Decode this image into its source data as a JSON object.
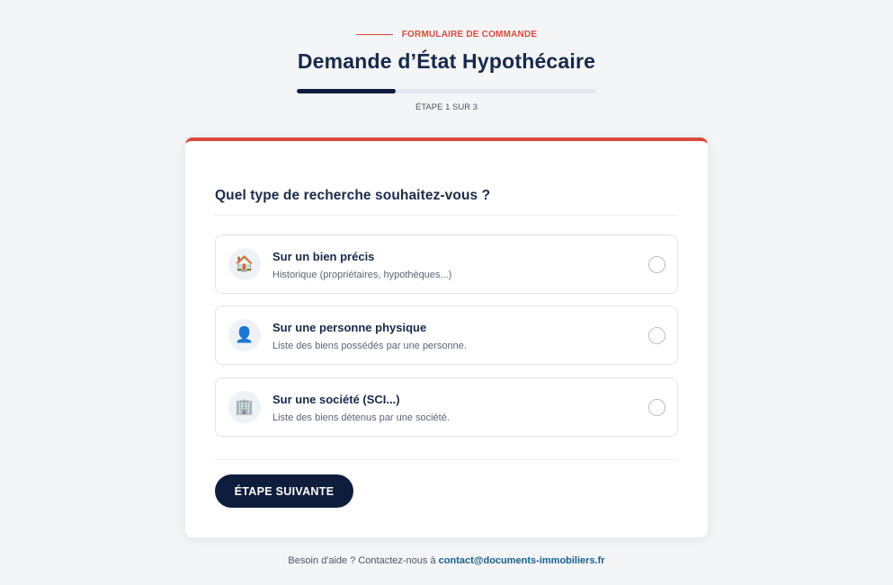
{
  "header": {
    "eyebrow": "FORMULAIRE DE COMMANDE",
    "title": "Demande d’État Hypothécaire",
    "progress_fraction": 0.33,
    "step_text": "ÉTAPE 1 SUR 3"
  },
  "form": {
    "question": "Quel type de recherche souhaitez-vous ?",
    "options": [
      {
        "icon": "🏠",
        "icon_name": "house-icon",
        "title": "Sur un bien précis",
        "description": "Historique (propriétaires, hypothèques...)",
        "selected": false
      },
      {
        "icon": "👤",
        "icon_name": "person-icon",
        "title": "Sur une personne physique",
        "description": "Liste des biens possédés par une personne.",
        "selected": false
      },
      {
        "icon": "🏢",
        "icon_name": "building-icon",
        "title": "Sur une société (SCI...)",
        "description": "Liste des biens détenus par une société.",
        "selected": false
      }
    ],
    "next_label": "ÉTAPE SUIVANTE"
  },
  "footer": {
    "text": "Besoin d'aide ? Contactez-nous à",
    "email": "contact@documents-immobiliers.fr"
  },
  "colors": {
    "accent": "#d94a3d",
    "primary": "#0f1d3d",
    "link": "#16608f",
    "background": "#f4f5f7"
  }
}
